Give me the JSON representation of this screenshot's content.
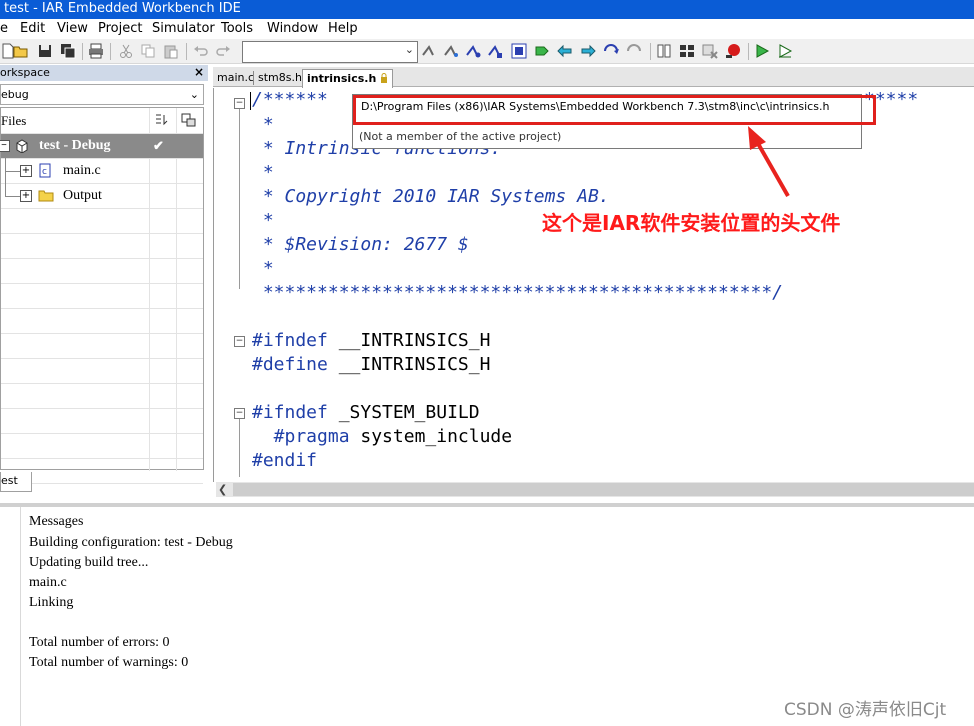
{
  "window": {
    "title": "test - IAR Embedded Workbench IDE"
  },
  "menu": [
    "e",
    "Edit",
    "View",
    "Project",
    "Simulator",
    "Tools",
    "Window",
    "Help"
  ],
  "toolbar": {
    "icons": [
      "new-file-icon",
      "open-icon",
      "save-icon",
      "save-all-icon",
      "print-icon",
      "cut-icon",
      "copy-icon",
      "paste-icon",
      "undo-icon",
      "redo-icon",
      "find-in-files-icon",
      "bookmark-icon",
      "debug-icon",
      "step-icon",
      "go-icon",
      "next-icon",
      "prev-icon",
      "compile-icon",
      "make-icon",
      "stop-icon",
      "download-debug-icon",
      "debug-without-download-icon"
    ]
  },
  "workspace": {
    "header": "orkspace",
    "close": "×",
    "config": "ebug",
    "files_header": "Files",
    "root": "test - Debug",
    "check": "✔",
    "items": [
      {
        "label": "main.c",
        "icon": "c-file-icon"
      },
      {
        "label": "Output",
        "icon": "folder-icon"
      }
    ],
    "tab": "est"
  },
  "editor": {
    "tabs": [
      {
        "label": "main.c"
      },
      {
        "label": "stm8s.h"
      },
      {
        "label": "intrinsics.h",
        "locked": true
      }
    ],
    "lines": {
      "l1a": "/******",
      "l1b": "*****",
      "l2": " *",
      "l3": " * Intrinsic functions.",
      "l4": " *",
      "l5": " * Copyright 2010 IAR Systems AB.",
      "l6": " *",
      "l7": " * $Revision: 2677 $",
      "l8": " *",
      "l9": " ***********************************************/",
      "l10a": "#ifndef",
      "l10b": " __INTRINSICS_H",
      "l11a": "#define",
      "l11b": " __INTRINSICS_H",
      "l12a": "#ifndef",
      "l12b": " _SYSTEM_BUILD",
      "l13a": "  #pragma",
      "l13b": " system_include",
      "l14": "#endif"
    },
    "tooltip": {
      "path": "D:\\Program Files (x86)\\IAR Systems\\Embedded Workbench 7.3\\stm8\\inc\\c\\intrinsics.h",
      "note": "(Not a member of the active project)"
    },
    "annotation": "这个是IAR软件安装位置的头文件",
    "colors": {
      "accent": "#e0201c",
      "code_blue": "#1f3fa8"
    }
  },
  "messages": {
    "header": "Messages",
    "lines": [
      "Building configuration: test - Debug",
      "Updating build tree...",
      "main.c",
      "Linking",
      "",
      "Total number of errors: 0",
      "Total number of warnings: 0"
    ]
  },
  "watermark": "CSDN @涛声依旧Cjt"
}
